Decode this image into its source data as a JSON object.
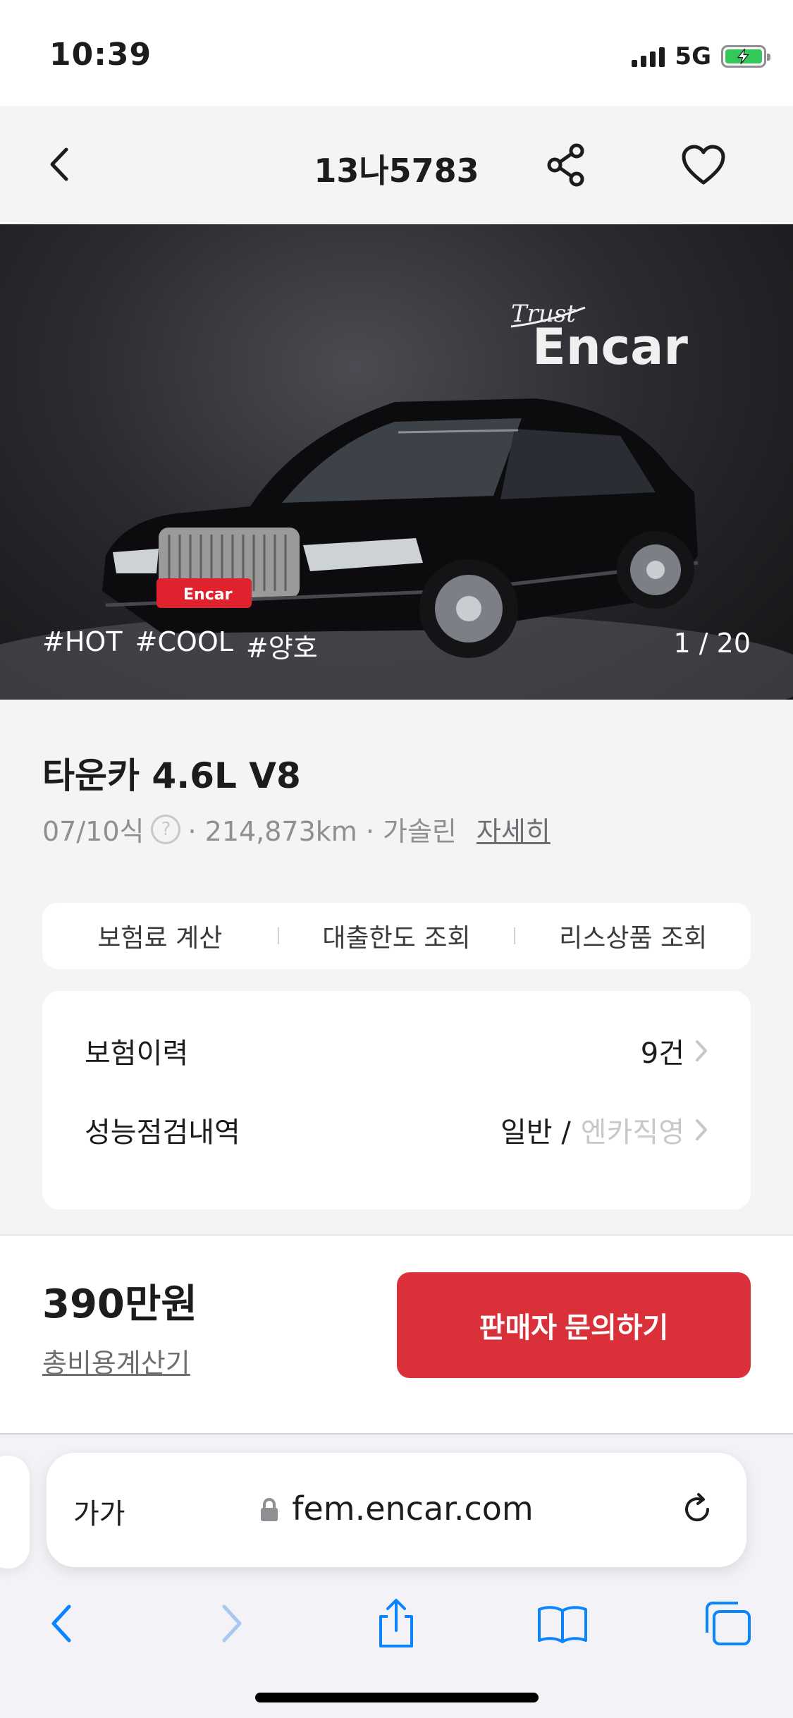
{
  "status_bar": {
    "time": "10:39",
    "network": "5G"
  },
  "header": {
    "title": "13나5783",
    "back_icon": "chevron-left-icon",
    "share_icon": "share-icon",
    "favorite_icon": "heart-icon"
  },
  "hero": {
    "tags": [
      "#HOT",
      "#COOL",
      "#양호"
    ],
    "counter": "1 / 20",
    "watermark_line1": "Trust",
    "watermark_line2": "Encar",
    "plate_text": "Encar"
  },
  "car": {
    "title": "타운카 4.6L V8",
    "year": "07/10식",
    "meta": "· 214,873km · 가솔린",
    "detail_link": "자세히"
  },
  "quick_actions": [
    "보험료 계산",
    "대출한도 조회",
    "리스상품 조회"
  ],
  "history": {
    "insurance_label": "보험이력",
    "insurance_value": "9건",
    "inspection_label": "성능점검내역",
    "inspection_value": "일반 /",
    "inspection_value_muted": "엔카직영"
  },
  "bottom": {
    "price": "390만원",
    "calc_link": "총비용계산기",
    "inquiry_button": "판매자 문의하기"
  },
  "colors": {
    "accent_red": "#d9303a",
    "battery_green": "#34c759"
  },
  "browser": {
    "font_button": "가가",
    "url": "fem.encar.com",
    "toolbar_icons": [
      "back-icon",
      "forward-icon",
      "share-icon",
      "bookmarks-icon",
      "tabs-icon"
    ]
  }
}
